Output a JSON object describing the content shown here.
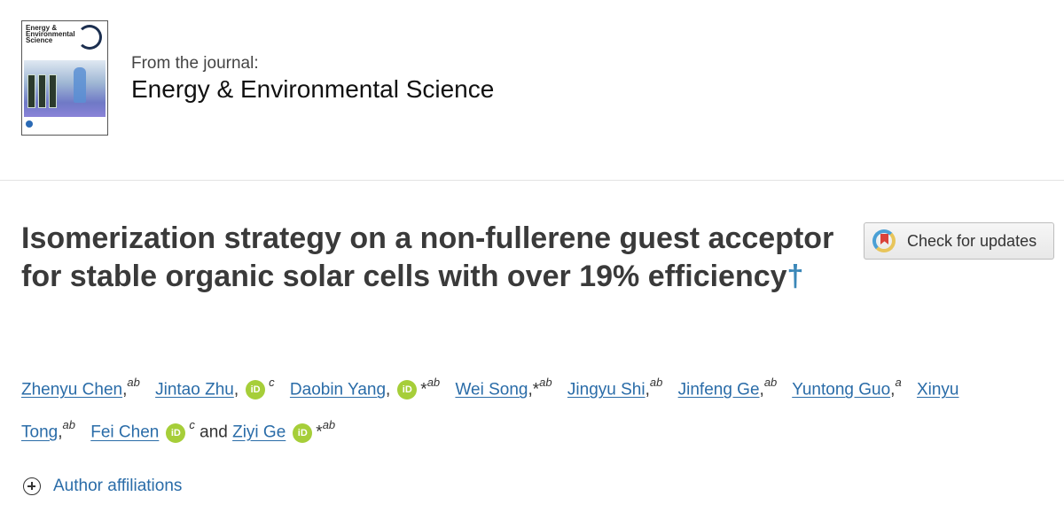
{
  "journal": {
    "cover_title": "Energy & Environmental Science",
    "from_label": "From the journal:",
    "name": "Energy & Environmental Science"
  },
  "article": {
    "title": "Isomerization strategy on a non-fullerene guest acceptor for stable organic solar cells with over 19% efficiency",
    "title_mark": "†",
    "check_updates_label": "Check for updates"
  },
  "authors": [
    {
      "name": "Zhenyu Chen",
      "sup": "ab",
      "orcid": false,
      "star": false
    },
    {
      "name": "Jintao Zhu",
      "sup": "c",
      "orcid": true,
      "star": false
    },
    {
      "name": "Daobin Yang",
      "sup": "ab",
      "orcid": true,
      "star": true
    },
    {
      "name": "Wei Song",
      "sup": "ab",
      "orcid": false,
      "star": true
    },
    {
      "name": "Jingyu Shi",
      "sup": "ab",
      "orcid": false,
      "star": false
    },
    {
      "name": "Jinfeng Ge",
      "sup": "ab",
      "orcid": false,
      "star": false
    },
    {
      "name": "Yuntong Guo",
      "sup": "a",
      "orcid": false,
      "star": false
    },
    {
      "name": "Xinyu Tong",
      "sup": "ab",
      "orcid": false,
      "star": false
    },
    {
      "name": "Fei Chen",
      "sup": "c",
      "orcid": true,
      "star": false
    },
    {
      "name": "Ziyi Ge",
      "sup": "ab",
      "orcid": true,
      "star": true
    }
  ],
  "authors_text": {
    "and": "and",
    "orcid_label": "iD",
    "xinyu_first": "Xinyu",
    "xinyu_second": "Tong"
  },
  "affiliations_label": "Author affiliations",
  "colors": {
    "link": "#2a6ca8",
    "orcid": "#a6ce39",
    "dagger": "#3b87b8"
  }
}
